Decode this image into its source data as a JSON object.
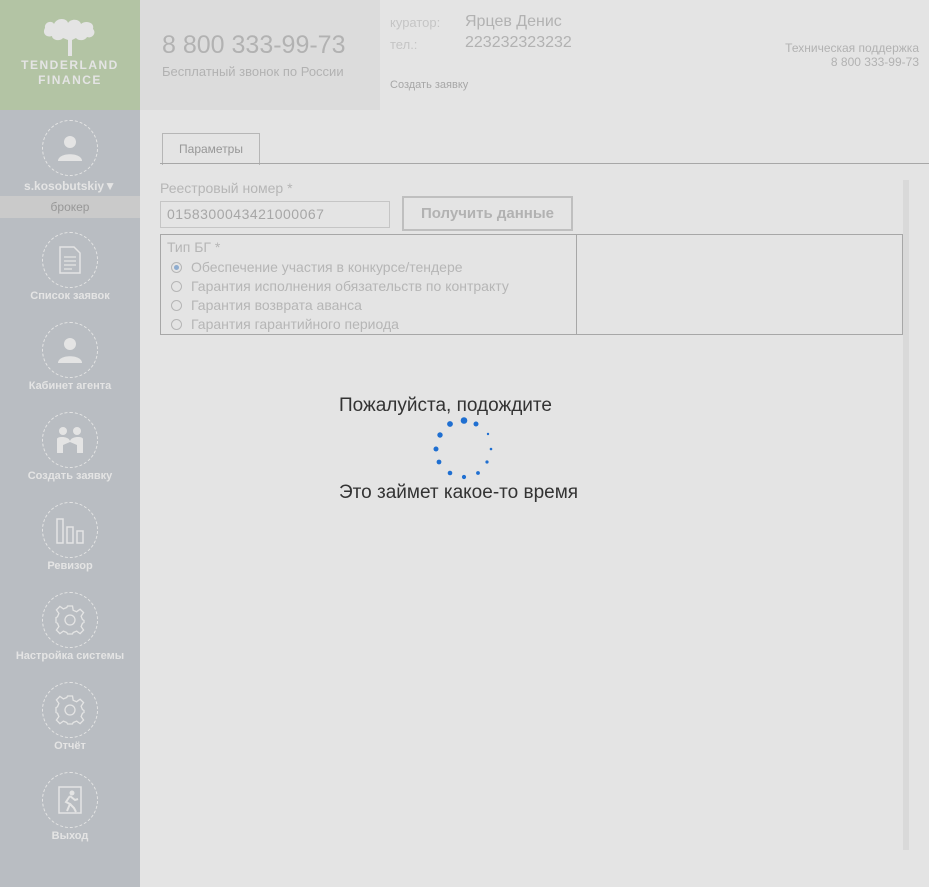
{
  "brand": {
    "line1": "TENDERLAND",
    "line2": "FINANCE"
  },
  "header": {
    "phone": "8 800 333-99-73",
    "phone_caption": "Бесплатный звонок по России",
    "curator_label": "куратор:",
    "curator_name": "Ярцев Денис",
    "tel_label": "тел.:",
    "tel_value": "223232323232",
    "create_request": "Создать заявку",
    "support_title": "Техническая поддержка",
    "support_phone": "8 800 333-99-73"
  },
  "user": {
    "name": "s.kosobutskiy▼",
    "role": "брокер"
  },
  "sidebar": {
    "items": [
      {
        "label": "Список заявок",
        "icon": "document-icon"
      },
      {
        "label": "Кабинет агента",
        "icon": "user-icon"
      },
      {
        "label": "Создать заявку",
        "icon": "handshake-icon"
      },
      {
        "label": "Ревизор",
        "icon": "bar-chart-icon"
      },
      {
        "label": "Настройка системы",
        "icon": "gear-icon"
      },
      {
        "label": "Отчёт",
        "icon": "gear-icon"
      },
      {
        "label": "Выход",
        "icon": "exit-icon"
      }
    ]
  },
  "form": {
    "tab": "Параметры",
    "registry_label": "Реестровый номер *",
    "registry_value": "0158300043421000067",
    "get_data_button": "Получить данные",
    "bg_type_label": "Тип БГ *",
    "bg_options": [
      {
        "label": "Обеспечение участия в конкурсе/тендере",
        "selected": true
      },
      {
        "label": "Гарантия исполнения обязательств по контракту",
        "selected": false
      },
      {
        "label": "Гарантия возврата аванса",
        "selected": false
      },
      {
        "label": "Гарантия гарантийного периода",
        "selected": false
      }
    ]
  },
  "loading": {
    "title": "Пожалуйста, подождите",
    "subtitle": "Это займет какое-то время"
  },
  "colors": {
    "sidebar": "#cfd4d9",
    "logo_bg": "#c9dcb8",
    "spinner": "#1f6fd1"
  }
}
